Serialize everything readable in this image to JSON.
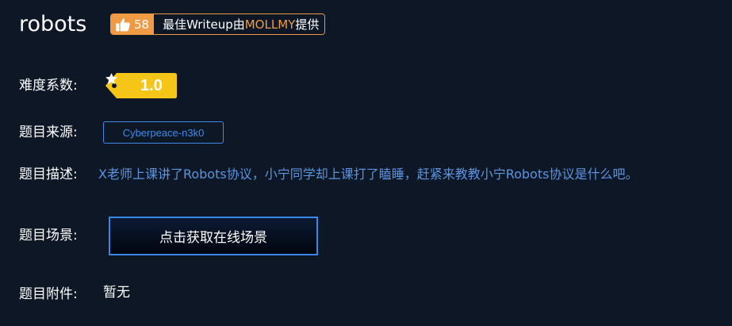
{
  "challenge": {
    "title": "robots",
    "likes": "58",
    "writeup_prefix": "最佳Writeup由",
    "writeup_author": "MOLLMY",
    "writeup_suffix": "提供"
  },
  "rows": {
    "difficulty_label": "难度系数:",
    "difficulty_value": "1.0",
    "source_label": "题目来源:",
    "source_value": "Cyberpeace-n3k0",
    "description_label": "题目描述:",
    "description_value": "X老师上课讲了Robots协议，小宁同学却上课打了瞌睡，赶紧来教教小宁Robots协议是什么吧。",
    "scene_label": "题目场景:",
    "scene_button": "点击获取在线场景",
    "attachment_label": "题目附件:",
    "attachment_value": "暂无"
  },
  "colors": {
    "background": "#0e1726",
    "accent_orange": "#f09a43",
    "accent_blue": "#3d8be8",
    "difficulty_yellow": "#f5c518"
  },
  "icons": {
    "like": "thumbs-up-icon",
    "difficulty": "star-icon"
  }
}
